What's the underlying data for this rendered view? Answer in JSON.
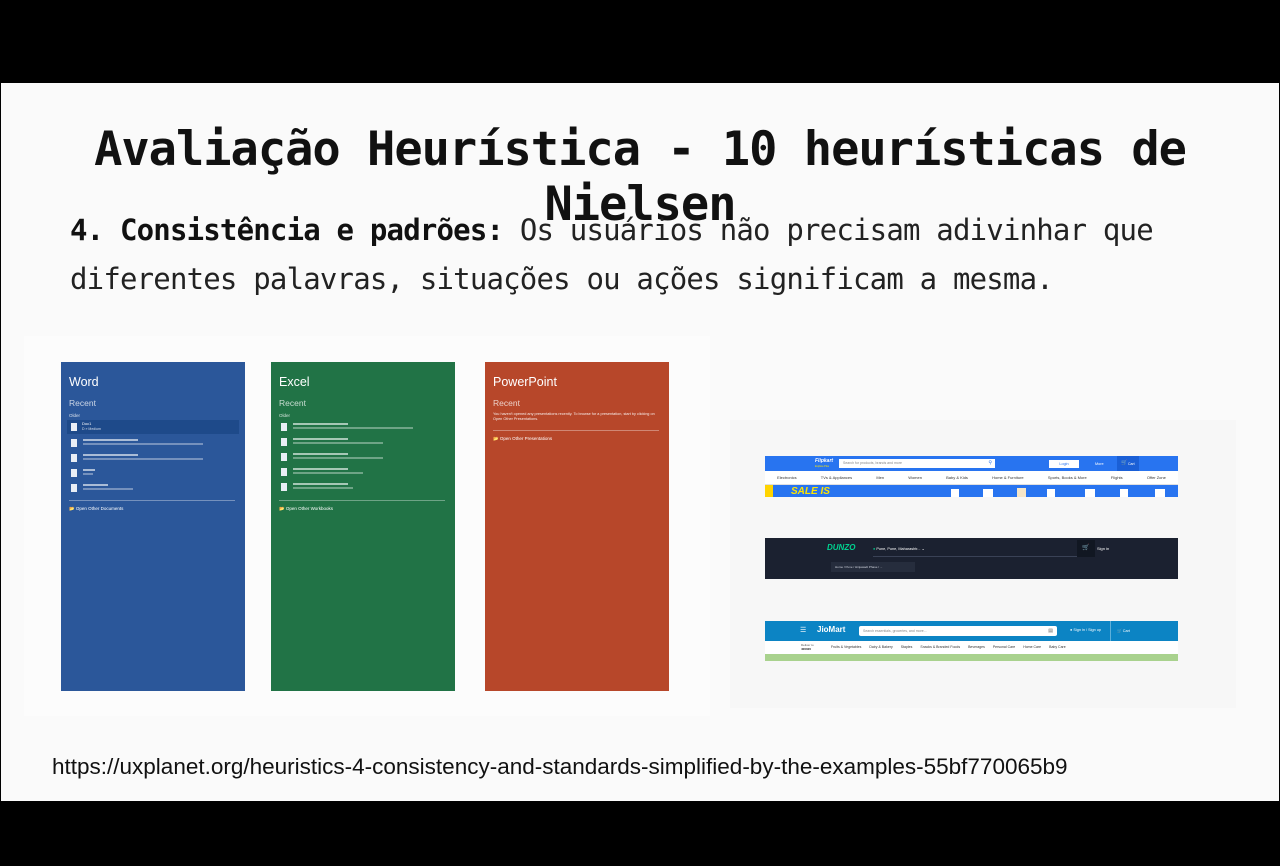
{
  "slide": {
    "title": "Avaliação Heurística - 10 heurísticas de Nielsen",
    "heading": "4. Consistência e padrões:",
    "body": " Os usuários não precisam adivinhar que diferentes palavras, situações ou ações significam a mesma.",
    "source_url": "https://uxplanet.org/heuristics-4-consistency-and-standards-simplified-by-the-examples-55bf770065b9"
  },
  "office": {
    "word": {
      "title": "Word",
      "recent": "Recent",
      "older": "Older",
      "file1": "Doc1",
      "file1_sub": "D » Medium",
      "open_other": "Open Other Documents",
      "color": "#2b579a"
    },
    "excel": {
      "title": "Excel",
      "recent": "Recent",
      "older": "Older",
      "open_other": "Open Other Workbooks",
      "color": "#217346"
    },
    "powerpoint": {
      "title": "PowerPoint",
      "recent": "Recent",
      "message": "You haven't opened any presentations recently. To browse for a presentation, start by clicking on Open Other Presentations.",
      "open_other": "Open Other Presentations",
      "color": "#b7472a"
    }
  },
  "sites": {
    "flipkart": {
      "logo": "Flipkart",
      "logo_sub": "Explore Plus",
      "search_placeholder": "Search for products, brands and more",
      "login": "Login",
      "more": "More",
      "cart": "Cart",
      "categories": [
        "Electronics",
        "TVs & Appliances",
        "Men",
        "Women",
        "Baby & Kids",
        "Home & Furniture",
        "Sports, Books & More",
        "Flights",
        "Offer Zone"
      ],
      "banner": "SALE IS",
      "color": "#2874f0"
    },
    "dunzo": {
      "logo": "DUNZO",
      "location": "Pune, Pune, Maharashtr...",
      "signin": "Sign in",
      "breadcrumb": "Home / Pune / Hinjawadi Phase / ...",
      "color": "#1b2130"
    },
    "jiomart": {
      "logo": "JioMart",
      "search_placeholder": "Search essentials, groceries, and more...",
      "signin": "Sign in / Sign up",
      "cart": "Cart",
      "deliver_to": "Deliver to",
      "pincode": "400020",
      "categories": [
        "Fruits & Vegetables",
        "Dairy & Bakery",
        "Staples",
        "Snacks & Branded Foods",
        "Beverages",
        "Personal Care",
        "Home Care",
        "Baby Care"
      ],
      "color": "#0c84c4"
    }
  }
}
